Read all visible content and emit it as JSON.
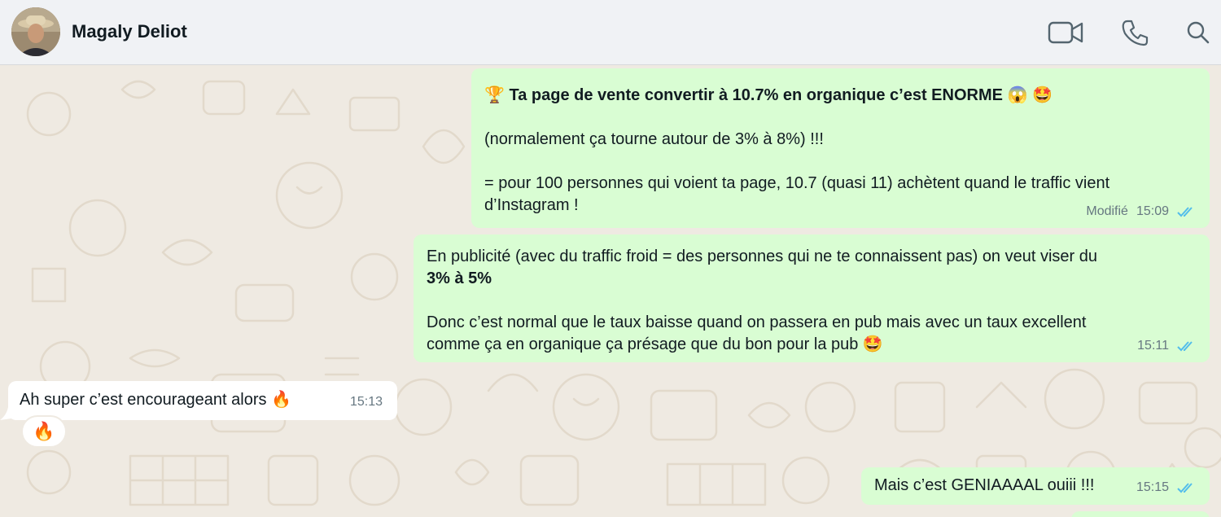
{
  "header": {
    "contact_name": "Magaly Deliot"
  },
  "messages": [
    {
      "direction": "out",
      "line1_emoji": "🏆",
      "line1_bold": "Ta page de vente convertir à 10.7% en organique c’est ENORME",
      "line1_end_emoji": "😱 🤩",
      "line2": "(normalement ça tourne autour de 3% à 8%) !!!",
      "line3": "= pour 100 personnes qui voient ta page, 10.7 (quasi 11) achètent quand le traffic vient",
      "line4": "d’Instagram !",
      "edited_label": "Modifié",
      "time": "15:09"
    },
    {
      "direction": "out",
      "line1": "En publicité (avec du traffic froid = des personnes qui ne te connaissent pas) on veut viser du",
      "line2_bold": "3% à 5%",
      "line3": "Donc c’est normal que le taux baisse quand on passera en pub mais avec un taux excellent",
      "line4": "comme ça en organique ça présage que du bon pour la pub 🤩",
      "time": "15:11"
    },
    {
      "direction": "in",
      "text": "Ah super c’est encourageant alors 🔥",
      "time": "15:13",
      "reaction": "🔥"
    },
    {
      "direction": "out",
      "text": "Mais c’est GENIAAAAL ouiii !!!",
      "time": "15:15"
    }
  ],
  "colors": {
    "outgoing_bubble": "#d9fdd3",
    "incoming_bubble": "#ffffff",
    "wallpaper": "#efeae2",
    "read_ticks": "#53bdeb"
  },
  "icons": [
    "video-call-icon",
    "voice-call-icon",
    "search-icon",
    "read-ticks-icon"
  ]
}
